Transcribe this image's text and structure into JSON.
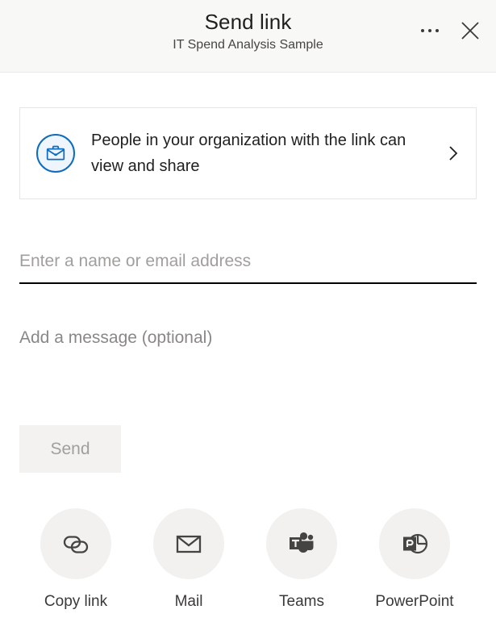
{
  "header": {
    "title": "Send link",
    "subtitle": "IT Spend Analysis Sample",
    "more_label": "More options",
    "close_label": "Close"
  },
  "permissions": {
    "text": "People in your organization with the link can view and share",
    "icon": "briefcase-icon",
    "chevron": "chevron-right-icon"
  },
  "recipients": {
    "placeholder": "Enter a name or email address",
    "value": ""
  },
  "message": {
    "placeholder": "Add a message (optional)",
    "value": ""
  },
  "send": {
    "label": "Send",
    "state": "disabled"
  },
  "share_options": [
    {
      "label": "Copy link",
      "icon": "link-icon"
    },
    {
      "label": "Mail",
      "icon": "mail-icon"
    },
    {
      "label": "Teams",
      "icon": "teams-icon"
    },
    {
      "label": "PowerPoint",
      "icon": "powerpoint-icon"
    }
  ],
  "colors": {
    "accent": "#0f6cbd",
    "header_bg": "#f8f8f7",
    "icon_bg": "#f2f1f0",
    "disabled_text": "#a19f9d"
  }
}
